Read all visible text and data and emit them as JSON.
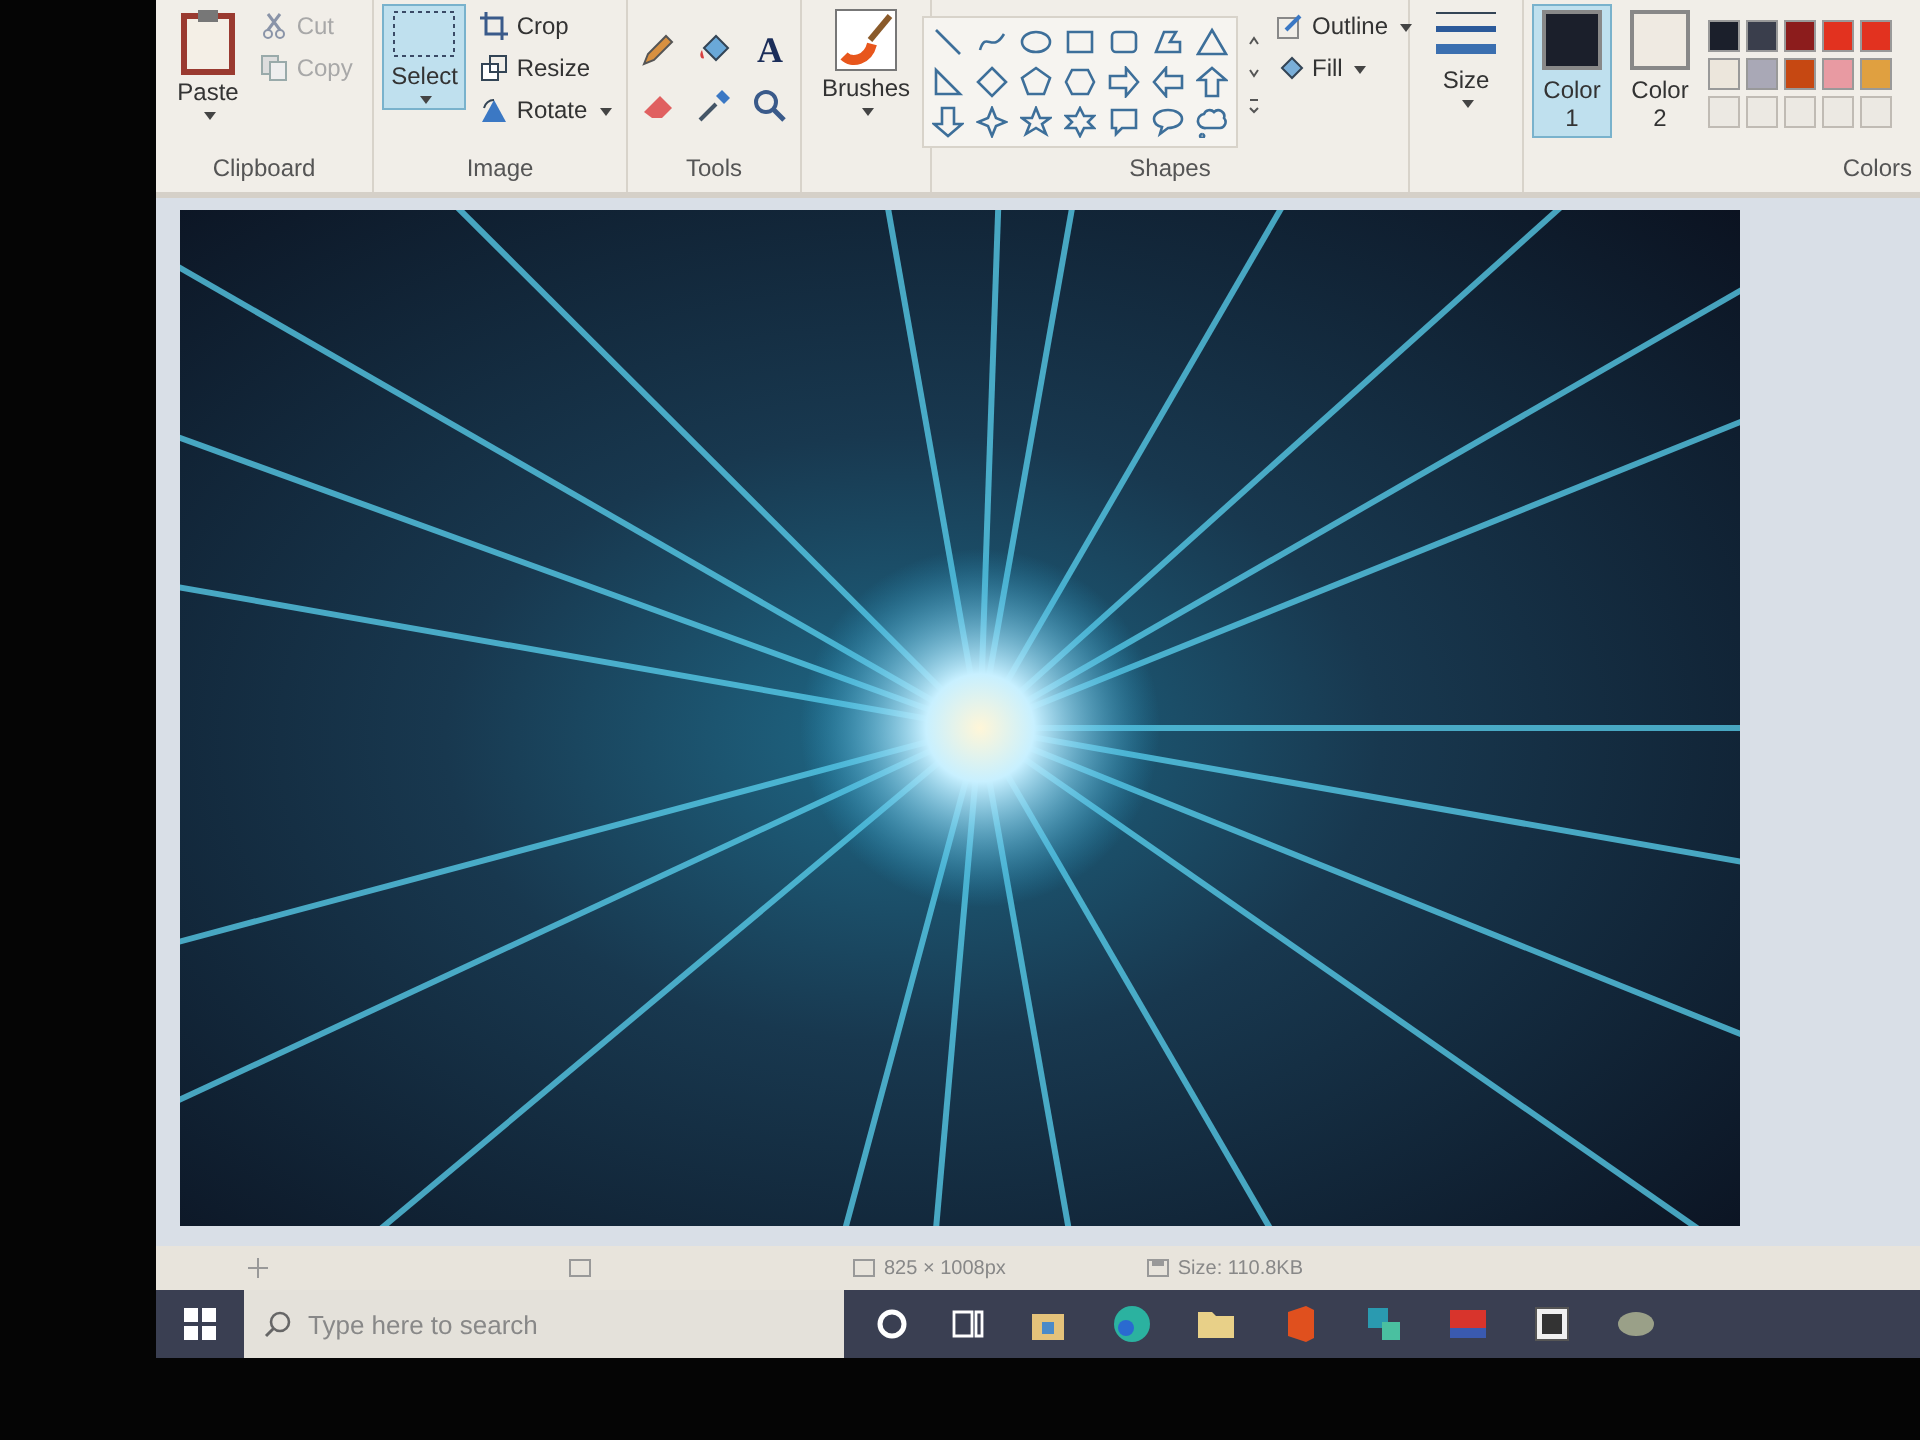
{
  "ribbon": {
    "clipboard": {
      "paste": "Paste",
      "cut": {
        "label": "Cut",
        "disabled": true
      },
      "copy": {
        "label": "Copy",
        "disabled": true
      },
      "label": "Clipboard"
    },
    "image": {
      "select": {
        "label": "Select",
        "selected": true
      },
      "crop": "Crop",
      "resize": "Resize",
      "rotate": "Rotate",
      "label": "Image"
    },
    "tools": {
      "label": "Tools",
      "text_tool": "A"
    },
    "brushes": {
      "label": "Brushes"
    },
    "shapes": {
      "outline": "Outline",
      "fill": "Fill",
      "label": "Shapes"
    },
    "size": {
      "label": "Size"
    },
    "colors": {
      "color1": {
        "label": "Color",
        "number": "1",
        "color": "#1b1f2b",
        "selected": true
      },
      "color2": {
        "label": "Color",
        "number": "2",
        "color": "#efeae2",
        "selected": false
      },
      "palette": [
        {
          "color": "#1b1f2b"
        },
        {
          "color": "#3a3e4c"
        },
        {
          "color": "#8c1c1c"
        },
        {
          "color": "#e2321f"
        },
        {
          "color": "#e2321f"
        },
        {
          "color": "#ece6dc"
        },
        {
          "color": "#a9a8b6"
        },
        {
          "color": "#c64812"
        },
        {
          "color": "#e89aa2"
        },
        {
          "color": "#e0a040"
        }
      ],
      "label": "Colors"
    }
  },
  "status_bar": {
    "dimensions": "825 × 1008px",
    "size": "Size: 110.8KB"
  },
  "taskbar": {
    "search": {
      "placeholder": "Type here to search"
    }
  }
}
